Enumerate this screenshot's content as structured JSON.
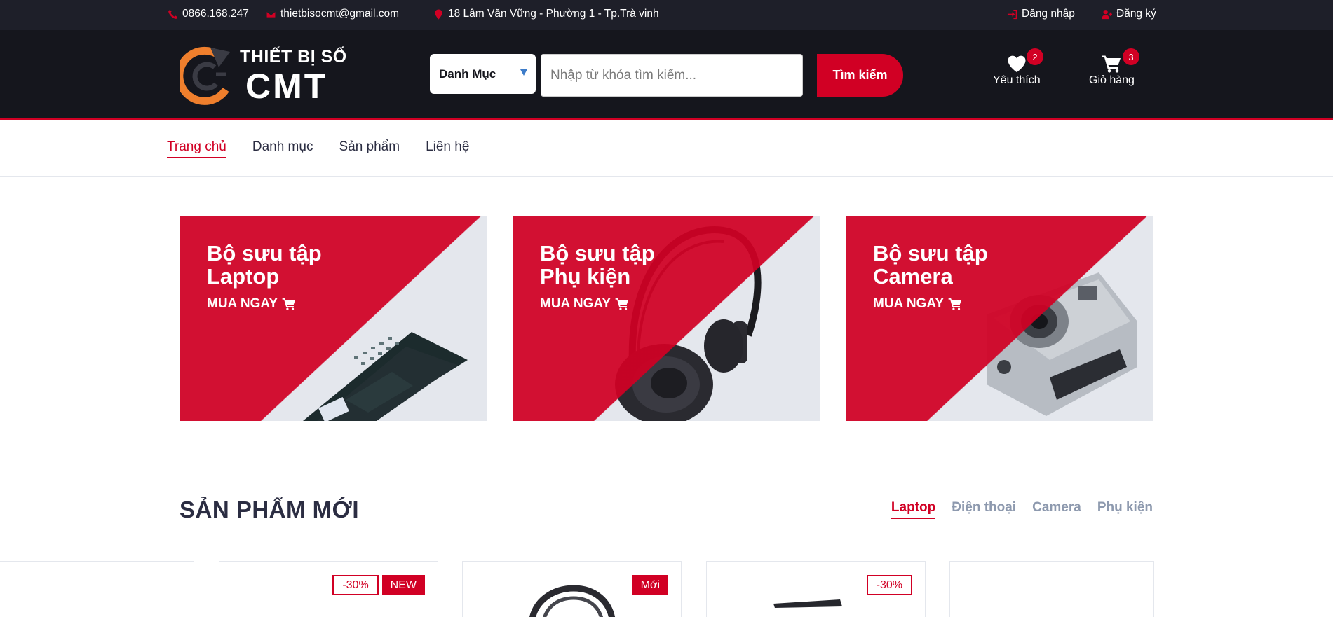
{
  "topbar": {
    "phone": "0866.168.247",
    "email": "thietbisocmt@gmail.com",
    "address": "18 Lâm Văn Vững - Phường 1 - Tp.Trà vinh",
    "login": "Đăng nhập",
    "register": "Đăng ký"
  },
  "logo": {
    "line1": "THIẾT BỊ SỐ",
    "line2": "CMT"
  },
  "search": {
    "category": "Danh Mục",
    "placeholder": "Nhập từ khóa tìm kiếm...",
    "button": "Tìm kiếm"
  },
  "header_icons": {
    "wishlist": {
      "label": "Yêu thích",
      "count": "2"
    },
    "cart": {
      "label": "Giỏ hàng",
      "count": "3"
    }
  },
  "nav": [
    "Trang chủ",
    "Danh mục",
    "Sản phẩm",
    "Liên hệ"
  ],
  "collections": [
    {
      "line1": "Bộ sưu tập",
      "line2": "Laptop",
      "cta": "MUA NGAY"
    },
    {
      "line1": "Bộ sưu tập",
      "line2": "Phụ kiện",
      "cta": "MUA NGAY"
    },
    {
      "line1": "Bộ sưu tập",
      "line2": "Camera",
      "cta": "MUA NGAY"
    }
  ],
  "section": {
    "title": "SẢN PHẨM MỚI",
    "tabs": [
      "Laptop",
      "Điện thoại",
      "Camera",
      "Phụ kiện"
    ]
  },
  "products": [
    {
      "sale": "-30%",
      "new": "NEW"
    },
    {
      "new": "Mới"
    },
    {
      "sale": "-30%"
    }
  ],
  "colors": {
    "accent": "#d10024",
    "dark": "#15161d",
    "topbar": "#1e1f29"
  }
}
